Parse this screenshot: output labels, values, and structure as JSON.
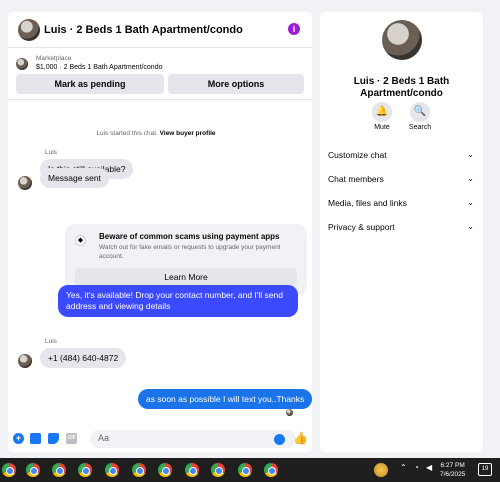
{
  "header": {
    "title": "Luis · 2 Beds 1 Bath Apartment/condo",
    "info_icon": "info-icon"
  },
  "marketplace": {
    "label": "Marketplace",
    "listing": "$1,000 · 2 Beds 1 Bath Apartment/condo"
  },
  "actions": {
    "pending": "Mark as pending",
    "more": "More options"
  },
  "system": {
    "started": "Luis started this chat.",
    "link": "View buyer profile"
  },
  "messages": {
    "sender1": "Luis",
    "m1": "Is this still available?",
    "m2": "Message sent",
    "scam_title": "Beware of common scams using payment apps",
    "scam_body": "Watch out for fake emails or requests to upgrade your payment account.",
    "learn_more": "Learn More",
    "reply1": "Yes, it's available! Drop your contact number, and I'll send address and viewing details",
    "sender2": "Luis",
    "m3": "+1 (484) 640-4872",
    "reply2": "as soon as possible I will text you..Thanks"
  },
  "composer": {
    "placeholder": "Aa"
  },
  "side": {
    "title": "Luis · 2 Beds 1 Bath Apartment/condo",
    "mute": "Mute",
    "search": "Search",
    "rows": [
      "Customize chat",
      "Chat members",
      "Media, files and links",
      "Privacy & support"
    ]
  },
  "taskbar": {
    "time": "6:27 PM",
    "date": "7/6/2025",
    "badge": "19"
  },
  "colors": {
    "accent": "#3b49ff",
    "bubble_blue": "#1a73e8",
    "info_purple": "#9b1bd6"
  }
}
